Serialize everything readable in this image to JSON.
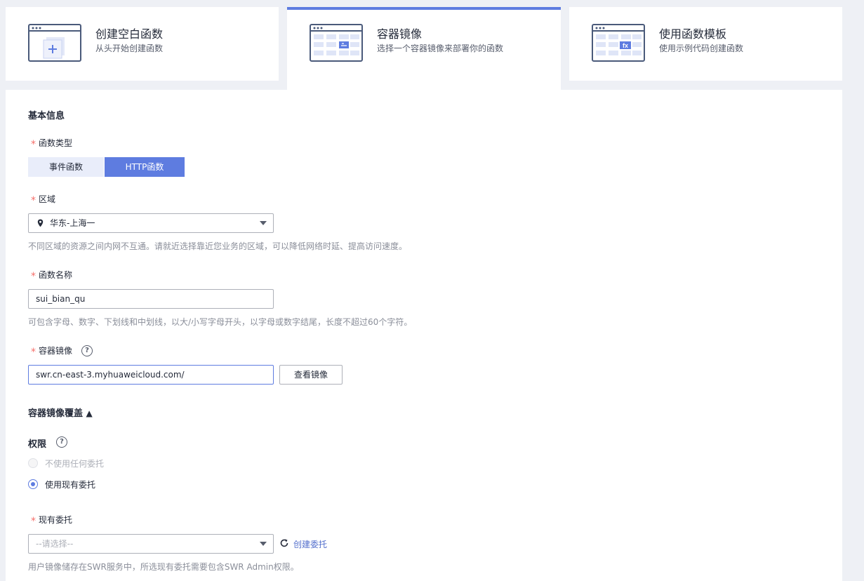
{
  "tabs": [
    {
      "title": "创建空白函数",
      "subtitle": "从头开始创建函数",
      "icon": "blank-function-illustration"
    },
    {
      "title": "容器镜像",
      "subtitle": "选择一个容器镜像来部署你的函数",
      "icon": "container-image-illustration",
      "active": true
    },
    {
      "title": "使用函数模板",
      "subtitle": "使用示例代码创建函数",
      "icon": "function-template-illustration"
    }
  ],
  "form": {
    "section_title": "基本信息",
    "required_mark": "*",
    "function_type": {
      "label": "函数类型",
      "options": [
        "事件函数",
        "HTTP函数"
      ],
      "selected": "HTTP函数"
    },
    "region": {
      "label": "区域",
      "value": "华东-上海一",
      "hint": "不同区域的资源之间内网不互通。请就近选择靠近您业务的区域，可以降低网络时延、提高访问速度。"
    },
    "function_name": {
      "label": "函数名称",
      "value": "sui_bian_qu",
      "hint": "可包含字母、数字、下划线和中划线，以大/小写字母开头，以字母或数字结尾，长度不超过60个字符。"
    },
    "container_image": {
      "label": "容器镜像",
      "help": "?",
      "value": "swr.cn-east-3.myhuaweicloud.com/",
      "view_button": "查看镜像"
    },
    "image_override": {
      "label": "容器镜像覆盖",
      "toggle": "▲"
    },
    "permission": {
      "label": "权限",
      "help": "?",
      "options": [
        {
          "label": "不使用任何委托",
          "disabled": true,
          "selected": false
        },
        {
          "label": "使用现有委托",
          "disabled": false,
          "selected": true
        }
      ]
    },
    "agency": {
      "label": "现有委托",
      "placeholder": "--请选择--",
      "refresh_icon": "refresh-icon",
      "create_link": "创建委托",
      "hint": "用户镜像储存在SWR服务中，所选现有委托需要包含SWR Admin权限。"
    }
  },
  "colors": {
    "accent": "#5e7ce0",
    "required": "#f66f6a",
    "link": "#526ecc"
  }
}
